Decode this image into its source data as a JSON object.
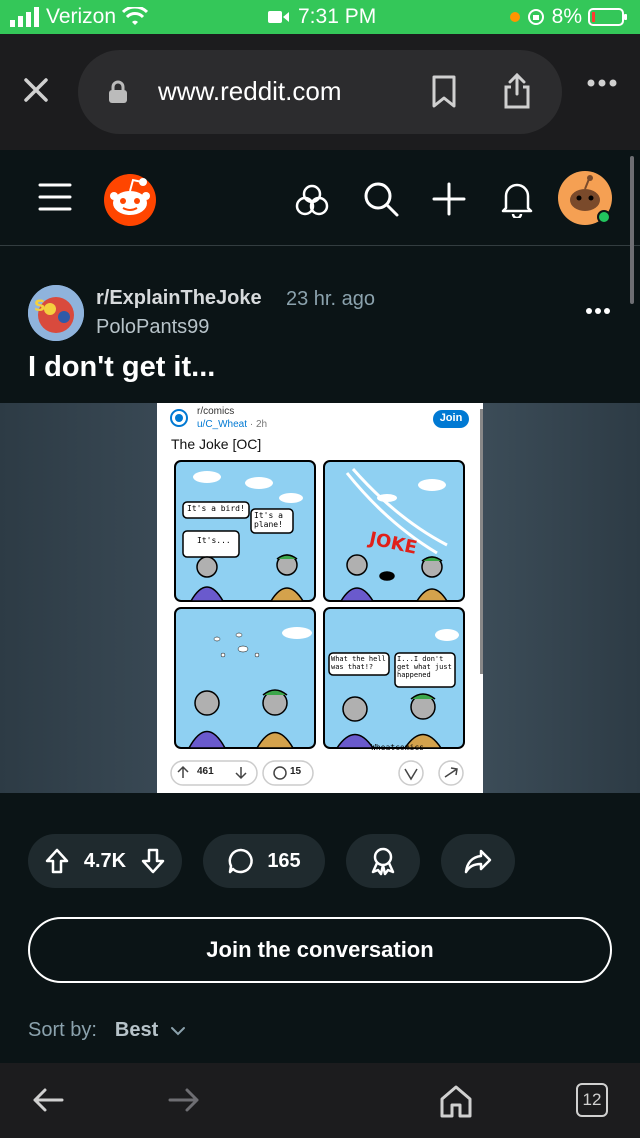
{
  "status_bar": {
    "carrier": "Verizon",
    "time": "7:31 PM",
    "battery": "8%"
  },
  "browser": {
    "url": "www.reddit.com"
  },
  "post": {
    "subreddit": "r/ExplainTheJoke",
    "time_ago": "23 hr. ago",
    "author": "PoloPants99",
    "title": "I don't get it..."
  },
  "embedded": {
    "subreddit": "r/comics",
    "author": "u/C_Wheat",
    "time": "2h",
    "join_label": "Join",
    "title": "The Joke [OC]",
    "panel1_bubble1": "It's a bird!",
    "panel1_bubble2": "It's a plane!",
    "panel1_bubble3": "It's...",
    "panel2_word": "JOKE",
    "panel4_bubble1": "What the hell was that!?",
    "panel4_bubble2": "I...I don't get what just happened",
    "signature": "Wheatcomics",
    "upvotes": "461",
    "comments": "15"
  },
  "actions": {
    "votes": "4.7K",
    "comments": "165"
  },
  "join_conversation": "Join the conversation",
  "sort": {
    "label": "Sort by:",
    "value": "Best"
  },
  "tabs_count": "12",
  "colors": {
    "reddit_orange": "#ff4500",
    "status_green": "#34c759",
    "background": "#0b1416"
  }
}
